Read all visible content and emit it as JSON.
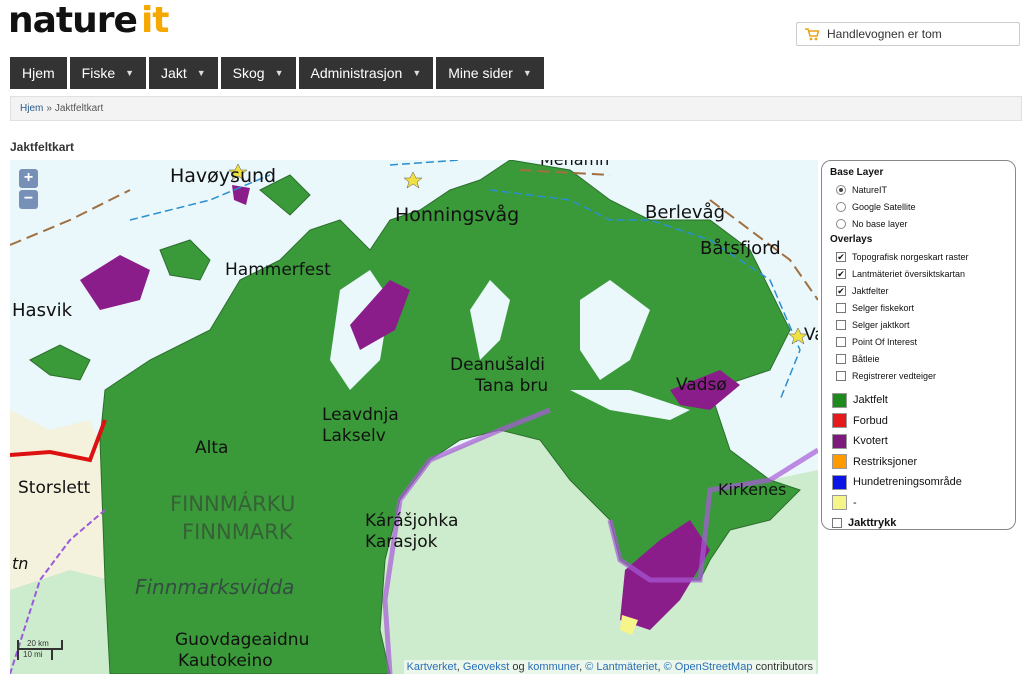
{
  "brand": {
    "word": "nature",
    "suffix": "it"
  },
  "cart": {
    "label": "Handlevognen er tom",
    "icon": "cart-icon"
  },
  "nav": [
    {
      "label": "Hjem",
      "dropdown": false
    },
    {
      "label": "Fiske",
      "dropdown": true
    },
    {
      "label": "Jakt",
      "dropdown": true
    },
    {
      "label": "Skog",
      "dropdown": true
    },
    {
      "label": "Administrasjon",
      "dropdown": true
    },
    {
      "label": "Mine sider",
      "dropdown": true
    }
  ],
  "breadcrumb": {
    "home": "Hjem",
    "separator": "»",
    "current": "Jaktfeltkart"
  },
  "page_title": "Jaktfeltkart",
  "map": {
    "zoom_in": "+",
    "zoom_out": "−",
    "scale_km": "20 km",
    "scale_mi": "10 mi",
    "attribution": {
      "a": "Kartverket",
      "b": "Geovekst",
      "og": "og",
      "c": "kommuner",
      "d": "© Lantmäteriet",
      "e": "© OpenStreetMap",
      "f": "contributors"
    },
    "places": {
      "havoysund": "Havøysund",
      "honningsvag": "Honningsvåg",
      "mehamn": "Mehamn",
      "berlevag": "Berlevåg",
      "batsfjord": "Båtsfjord",
      "hammerfest": "Hammerfest",
      "hasvik": "Hasvik",
      "deanusaldi": "Deanušaldi",
      "tana": "Tana bru",
      "vadso": "Vadsø",
      "vardo": "Va",
      "leavdnja": "Leavdnja",
      "lakselv": "Lakselv",
      "alta": "Alta",
      "storslett": "Storslett",
      "finnmarku": "FINNMÁRKU",
      "finnmark": "FINNMARK",
      "karasjohka": "Kárášjohka",
      "karasjok": "Karasjok",
      "kirkenes": "Kirkenes",
      "finnmarksvidda": "Finnmarksvidda",
      "guovdageaidnu": "Guovdageaidnu",
      "kautokeino": "Kautokeino",
      "tn": "tn"
    }
  },
  "layers": {
    "base_title": "Base Layer",
    "base": [
      {
        "label": "NatureIT",
        "selected": true
      },
      {
        "label": "Google Satellite",
        "selected": false
      },
      {
        "label": "No base layer",
        "selected": false
      }
    ],
    "overlays_title": "Overlays",
    "overlays": [
      {
        "label": "Topografisk norgeskart raster",
        "checked": true
      },
      {
        "label": "Lantmäteriet översiktskartan",
        "checked": true
      },
      {
        "label": "Jaktfelter",
        "checked": true
      },
      {
        "label": "Selger fiskekort",
        "checked": false
      },
      {
        "label": "Selger jaktkort",
        "checked": false
      },
      {
        "label": "Point Of Interest",
        "checked": false
      },
      {
        "label": "Båtleie",
        "checked": false
      },
      {
        "label": "Registrerer vedteiger",
        "checked": false
      }
    ],
    "legend": [
      {
        "label": "Jaktfelt",
        "color": "#1e8a1e"
      },
      {
        "label": "Forbud",
        "color": "#e41a1c"
      },
      {
        "label": "Kvotert",
        "color": "#7b1a7b"
      },
      {
        "label": "Restriksjoner",
        "color": "#ff9a00"
      },
      {
        "label": "Hundetreningsområde",
        "color": "#0a14e6"
      },
      {
        "label": "-",
        "color": "#f5f58a"
      }
    ],
    "jakttrykk": {
      "label": "Jakttrykk",
      "checked": false
    }
  }
}
